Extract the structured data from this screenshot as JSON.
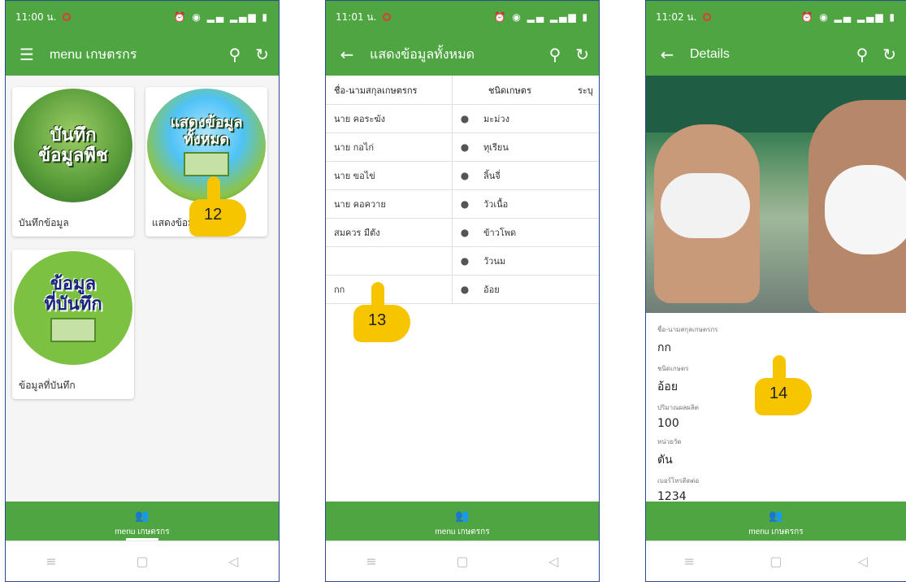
{
  "screens": [
    {
      "status_time": "11:00 น.",
      "status_icons": "⏰ ◉ ▂▄ ▂▄▆ ▮",
      "title": "menu เกษตรกร",
      "leading_icon": "menu-icon",
      "cards": [
        {
          "image_text": "บันทึก\nข้อมูลพืช",
          "label": "บันทึกข้อมูล"
        },
        {
          "image_text": "แสดงข้อมูล\nทั้งหมด",
          "label": "แสดงข้อมูล"
        },
        {
          "image_text": "ข้อมูล\nที่บันทึก",
          "label": "ข้อมูลที่บันทึก"
        }
      ],
      "nav_label": "menu เกษตรกร",
      "annotation": "12"
    },
    {
      "status_time": "11:01 น.",
      "status_icons": "⏰ ◉ ▂▄ ▂▄▆ ▮",
      "title": "แสดงข้อมูลทั้งหมด",
      "leading_icon": "back-arrow-icon",
      "table": {
        "headers": [
          "ชื่อ-นามสกุลเกษตรกร",
          "ชนิดเกษตร",
          "ระบุ"
        ],
        "rows": [
          {
            "name": "นาย คอระฆัง",
            "type": "มะม่วง"
          },
          {
            "name": "นาย กอไก่",
            "type": "ทุเรียน"
          },
          {
            "name": "นาย ขอไข่",
            "type": "ลิ้นจี่"
          },
          {
            "name": "นาย คอควาย",
            "type": "วัวเนื้อ"
          },
          {
            "name": "สมควร มีตัง",
            "type": "ข้าวโพด"
          },
          {
            "name": "",
            "type": "วัวนม"
          },
          {
            "name": "กก",
            "type": "อ้อย"
          }
        ]
      },
      "nav_label": "menu เกษตรกร",
      "annotation": "13"
    },
    {
      "status_time": "11:02 น.",
      "status_icons": "⏰ ◉ ▂▄ ▂▄▆ ▮",
      "title": "Details",
      "leading_icon": "back-arrow-icon",
      "fields": [
        {
          "label": "ชื่อ-นามสกุลเกษตรกร",
          "value": "กก"
        },
        {
          "label": "ชนิดเกษตร",
          "value": "อ้อย"
        },
        {
          "label": "ปริมาณผลผลิต",
          "value": "100"
        },
        {
          "label": "หน่วยวัด",
          "value": "ตัน"
        },
        {
          "label": "เบอร์โทรติดต่อ",
          "value": "1234"
        }
      ],
      "nav_label": "menu เกษตรกร",
      "annotation": "14"
    }
  ],
  "colors": {
    "primary": "#4ea542",
    "annotation": "#f7c500"
  }
}
